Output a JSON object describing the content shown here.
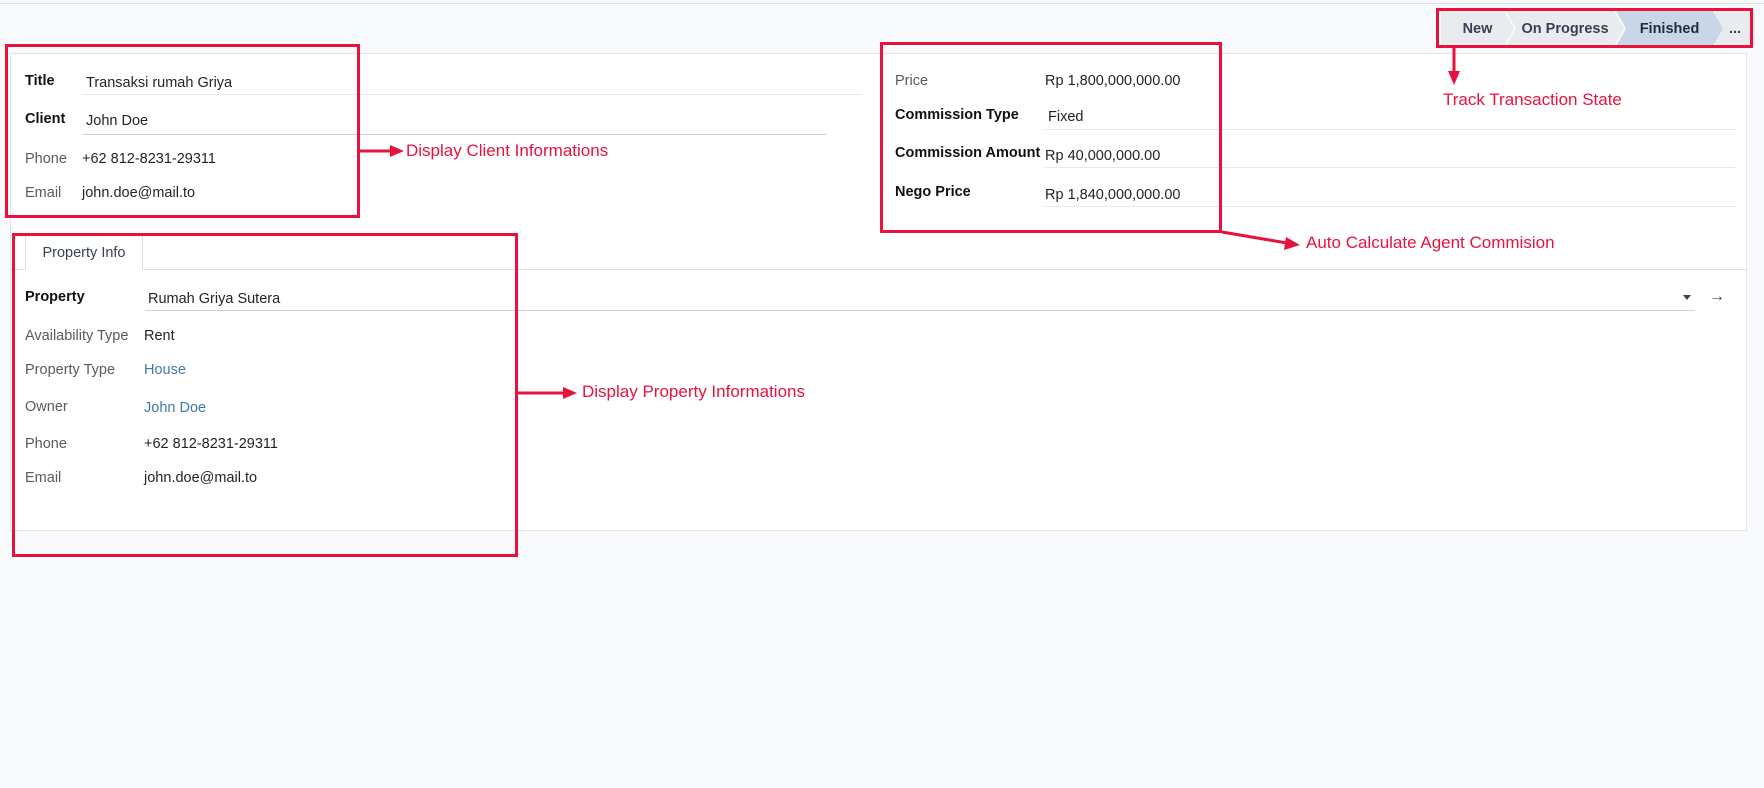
{
  "statusbar": {
    "stages": [
      "New",
      "On Progress",
      "Finished"
    ],
    "active": "Finished",
    "more": "..."
  },
  "client": {
    "title_label": "Title",
    "title_value": "Transaksi rumah Griya",
    "client_label": "Client",
    "client_value": "John Doe",
    "phone_label": "Phone",
    "phone_value": "+62 812-8231-29311",
    "email_label": "Email",
    "email_value": "john.doe@mail.to"
  },
  "pricing": {
    "price_label": "Price",
    "price_value": "Rp 1,800,000,000.00",
    "commission_type_label": "Commission Type",
    "commission_type_value": "Fixed",
    "commission_amount_label": "Commission Amount",
    "commission_amount_value": "Rp 40,000,000.00",
    "nego_price_label": "Nego Price",
    "nego_price_value": "Rp 1,840,000,000.00"
  },
  "tabs": [
    "Property Info"
  ],
  "property": {
    "property_label": "Property",
    "property_value": "Rumah Griya Sutera",
    "availability_label": "Availability Type",
    "availability_value": "Rent",
    "type_label": "Property Type",
    "type_value": "House",
    "owner_label": "Owner",
    "owner_value": "John Doe",
    "phone_label": "Phone",
    "phone_value": "+62 812-8231-29311",
    "email_label": "Email",
    "email_value": "john.doe@mail.to"
  },
  "annotations": {
    "client": "Display Client Informations",
    "commission": "Auto Calculate Agent Commision",
    "property": "Display Property Informations",
    "state": "Track Transaction State"
  },
  "colors": {
    "annotation": "#e8123f",
    "link": "#3f7aa8",
    "active_stage": "#c8d7e6"
  }
}
